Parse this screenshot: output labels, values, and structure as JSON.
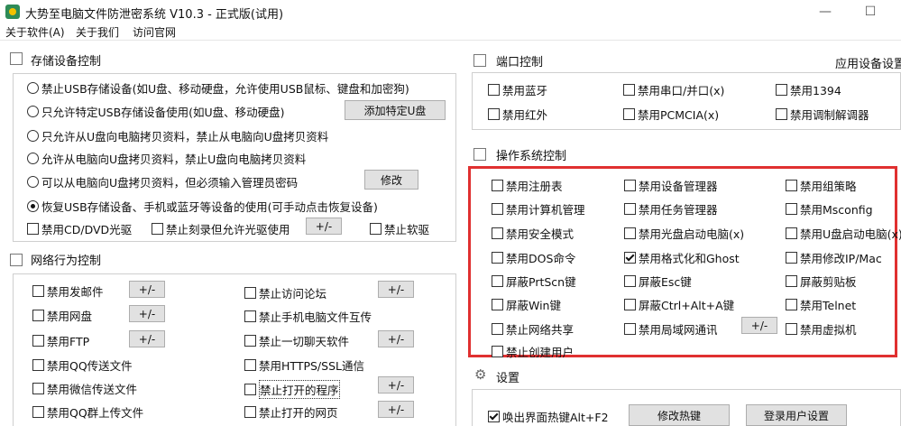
{
  "window": {
    "title": "大势至电脑文件防泄密系统 V10.3 - 正式版(试用)",
    "minimize": "—",
    "maximize": "☐"
  },
  "menu": [
    "关于软件(A)",
    "关于我们",
    "访问官网"
  ],
  "storage": {
    "title": "存储设备控制",
    "radios": [
      "禁止USB存储设备(如U盘、移动硬盘，允许使用USB鼠标、键盘和加密狗)",
      "只允许特定USB存储设备使用(如U盘、移动硬盘)",
      "只允许从U盘向电脑拷贝资料，禁止从电脑向U盘拷贝资料",
      "允许从电脑向U盘拷贝资料，禁止U盘向电脑拷贝资料",
      "可以从电脑向U盘拷贝资料，但必须输入管理员密码",
      "恢复USB存储设备、手机或蓝牙等设备的使用(可手动点击恢复设备)"
    ],
    "add_button": "添加特定U盘",
    "modify_button": "修改",
    "cd_label": "禁用CD/DVD光驱",
    "burn_label": "禁止刻录但允许光驱使用",
    "pm_button": "+/-",
    "floppy_label": "禁止软驱"
  },
  "network": {
    "title": "网络行为控制",
    "left": [
      "禁用发邮件",
      "禁用网盘",
      "禁用FTP",
      "禁用QQ传送文件",
      "禁用微信传送文件",
      "禁用QQ群上传文件"
    ],
    "right": [
      "禁止访问论坛",
      "禁止手机电脑文件互传",
      "禁止一切聊天软件",
      "禁用HTTPS/SSL通信",
      "禁止打开的程序",
      "禁止打开的网页"
    ],
    "pm": "+/-"
  },
  "port": {
    "title": "端口控制",
    "app_settings": "应用设备设置",
    "items": [
      "禁用蓝牙",
      "禁用串口/并口(x)",
      "禁用1394",
      "禁用红外",
      "禁用PCMCIA(x)",
      "禁用调制解调器"
    ]
  },
  "os": {
    "title": "操作系统控制",
    "items": [
      "禁用注册表",
      "禁用设备管理器",
      "禁用组策略",
      "禁用计算机管理",
      "禁用任务管理器",
      "禁用Msconfig",
      "禁用安全模式",
      "禁用光盘启动电脑(x)",
      "禁用U盘启动电脑(x)",
      "禁用DOS命令",
      "禁用格式化和Ghost",
      "禁用修改IP/Mac",
      "屏蔽PrtScn键",
      "屏蔽Esc键",
      "屏蔽剪贴板",
      "屏蔽Win键",
      "屏蔽Ctrl+Alt+A键",
      "禁用Telnet",
      "禁止网络共享",
      "禁用局域网通讯",
      "禁用虚拟机",
      "禁止创建用户"
    ],
    "pm": "+/-"
  },
  "settings": {
    "title": "设置",
    "hotkey_label": "唤出界面热键Alt+F2",
    "modify_hotkey": "修改热键",
    "login_settings": "登录用户设置"
  }
}
